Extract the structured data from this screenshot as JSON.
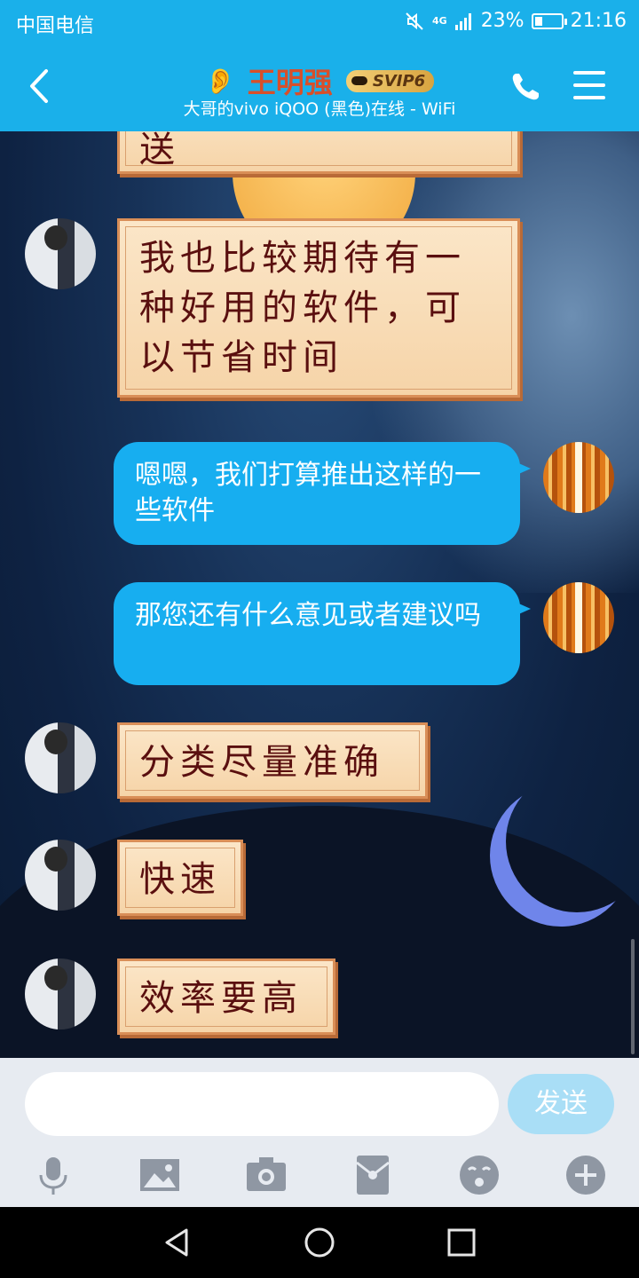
{
  "status_bar": {
    "carrier": "中国电信",
    "network": "4G",
    "battery": "23%",
    "time": "21:16"
  },
  "header": {
    "contact_name": "王明强",
    "badge": "SVIP6",
    "subtitle": "大哥的vivo iQOO (黑色)在线 - WiFi"
  },
  "messages": [
    {
      "from": "contact",
      "text": "送",
      "style": "scroll"
    },
    {
      "from": "contact",
      "text": "我也比较期待有一种好用的软件，可以节省时间",
      "style": "scroll"
    },
    {
      "from": "me",
      "text": "嗯嗯，我们打算推出这样的一些软件",
      "style": "blue"
    },
    {
      "from": "me",
      "text": "那您还有什么意见或者建议吗",
      "style": "blue"
    },
    {
      "from": "contact",
      "text": "分类尽量准确",
      "style": "scroll"
    },
    {
      "from": "contact",
      "text": "快速",
      "style": "scroll"
    },
    {
      "from": "contact",
      "text": "效率要高",
      "style": "scroll"
    }
  ],
  "composer": {
    "input_value": "",
    "send_label": "发送",
    "tools": [
      "microphone-icon",
      "image-icon",
      "camera-icon",
      "red-packet-icon",
      "emoji-icon",
      "plus-icon"
    ]
  },
  "colors": {
    "header_bg": "#1ab0ea",
    "bubble_blue": "#17aef0",
    "name_color": "#d84f2a",
    "send_disabled": "#a9def6"
  }
}
